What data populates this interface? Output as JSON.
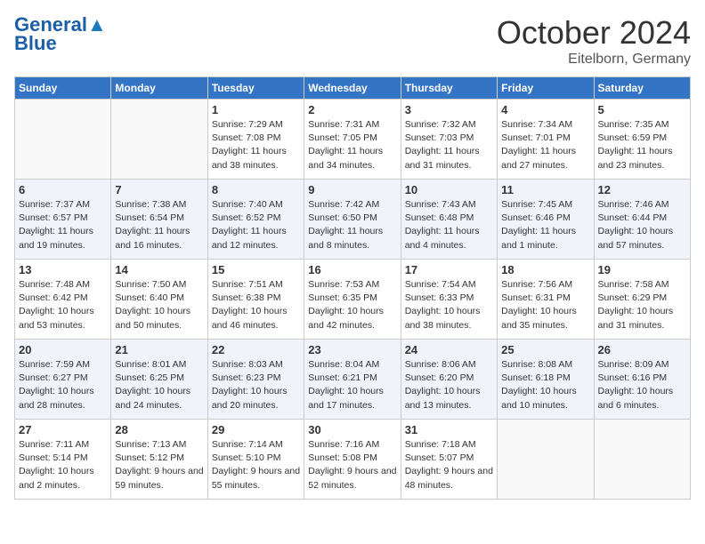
{
  "header": {
    "logo_line1": "General",
    "logo_line2": "Blue",
    "title": "October 2024",
    "subtitle": "Eitelborn, Germany"
  },
  "weekdays": [
    "Sunday",
    "Monday",
    "Tuesday",
    "Wednesday",
    "Thursday",
    "Friday",
    "Saturday"
  ],
  "weeks": [
    [
      {
        "day": "",
        "info": ""
      },
      {
        "day": "",
        "info": ""
      },
      {
        "day": "1",
        "info": "Sunrise: 7:29 AM\nSunset: 7:08 PM\nDaylight: 11 hours and 38 minutes."
      },
      {
        "day": "2",
        "info": "Sunrise: 7:31 AM\nSunset: 7:05 PM\nDaylight: 11 hours and 34 minutes."
      },
      {
        "day": "3",
        "info": "Sunrise: 7:32 AM\nSunset: 7:03 PM\nDaylight: 11 hours and 31 minutes."
      },
      {
        "day": "4",
        "info": "Sunrise: 7:34 AM\nSunset: 7:01 PM\nDaylight: 11 hours and 27 minutes."
      },
      {
        "day": "5",
        "info": "Sunrise: 7:35 AM\nSunset: 6:59 PM\nDaylight: 11 hours and 23 minutes."
      }
    ],
    [
      {
        "day": "6",
        "info": "Sunrise: 7:37 AM\nSunset: 6:57 PM\nDaylight: 11 hours and 19 minutes."
      },
      {
        "day": "7",
        "info": "Sunrise: 7:38 AM\nSunset: 6:54 PM\nDaylight: 11 hours and 16 minutes."
      },
      {
        "day": "8",
        "info": "Sunrise: 7:40 AM\nSunset: 6:52 PM\nDaylight: 11 hours and 12 minutes."
      },
      {
        "day": "9",
        "info": "Sunrise: 7:42 AM\nSunset: 6:50 PM\nDaylight: 11 hours and 8 minutes."
      },
      {
        "day": "10",
        "info": "Sunrise: 7:43 AM\nSunset: 6:48 PM\nDaylight: 11 hours and 4 minutes."
      },
      {
        "day": "11",
        "info": "Sunrise: 7:45 AM\nSunset: 6:46 PM\nDaylight: 11 hours and 1 minute."
      },
      {
        "day": "12",
        "info": "Sunrise: 7:46 AM\nSunset: 6:44 PM\nDaylight: 10 hours and 57 minutes."
      }
    ],
    [
      {
        "day": "13",
        "info": "Sunrise: 7:48 AM\nSunset: 6:42 PM\nDaylight: 10 hours and 53 minutes."
      },
      {
        "day": "14",
        "info": "Sunrise: 7:50 AM\nSunset: 6:40 PM\nDaylight: 10 hours and 50 minutes."
      },
      {
        "day": "15",
        "info": "Sunrise: 7:51 AM\nSunset: 6:38 PM\nDaylight: 10 hours and 46 minutes."
      },
      {
        "day": "16",
        "info": "Sunrise: 7:53 AM\nSunset: 6:35 PM\nDaylight: 10 hours and 42 minutes."
      },
      {
        "day": "17",
        "info": "Sunrise: 7:54 AM\nSunset: 6:33 PM\nDaylight: 10 hours and 38 minutes."
      },
      {
        "day": "18",
        "info": "Sunrise: 7:56 AM\nSunset: 6:31 PM\nDaylight: 10 hours and 35 minutes."
      },
      {
        "day": "19",
        "info": "Sunrise: 7:58 AM\nSunset: 6:29 PM\nDaylight: 10 hours and 31 minutes."
      }
    ],
    [
      {
        "day": "20",
        "info": "Sunrise: 7:59 AM\nSunset: 6:27 PM\nDaylight: 10 hours and 28 minutes."
      },
      {
        "day": "21",
        "info": "Sunrise: 8:01 AM\nSunset: 6:25 PM\nDaylight: 10 hours and 24 minutes."
      },
      {
        "day": "22",
        "info": "Sunrise: 8:03 AM\nSunset: 6:23 PM\nDaylight: 10 hours and 20 minutes."
      },
      {
        "day": "23",
        "info": "Sunrise: 8:04 AM\nSunset: 6:21 PM\nDaylight: 10 hours and 17 minutes."
      },
      {
        "day": "24",
        "info": "Sunrise: 8:06 AM\nSunset: 6:20 PM\nDaylight: 10 hours and 13 minutes."
      },
      {
        "day": "25",
        "info": "Sunrise: 8:08 AM\nSunset: 6:18 PM\nDaylight: 10 hours and 10 minutes."
      },
      {
        "day": "26",
        "info": "Sunrise: 8:09 AM\nSunset: 6:16 PM\nDaylight: 10 hours and 6 minutes."
      }
    ],
    [
      {
        "day": "27",
        "info": "Sunrise: 7:11 AM\nSunset: 5:14 PM\nDaylight: 10 hours and 2 minutes."
      },
      {
        "day": "28",
        "info": "Sunrise: 7:13 AM\nSunset: 5:12 PM\nDaylight: 9 hours and 59 minutes."
      },
      {
        "day": "29",
        "info": "Sunrise: 7:14 AM\nSunset: 5:10 PM\nDaylight: 9 hours and 55 minutes."
      },
      {
        "day": "30",
        "info": "Sunrise: 7:16 AM\nSunset: 5:08 PM\nDaylight: 9 hours and 52 minutes."
      },
      {
        "day": "31",
        "info": "Sunrise: 7:18 AM\nSunset: 5:07 PM\nDaylight: 9 hours and 48 minutes."
      },
      {
        "day": "",
        "info": ""
      },
      {
        "day": "",
        "info": ""
      }
    ]
  ]
}
